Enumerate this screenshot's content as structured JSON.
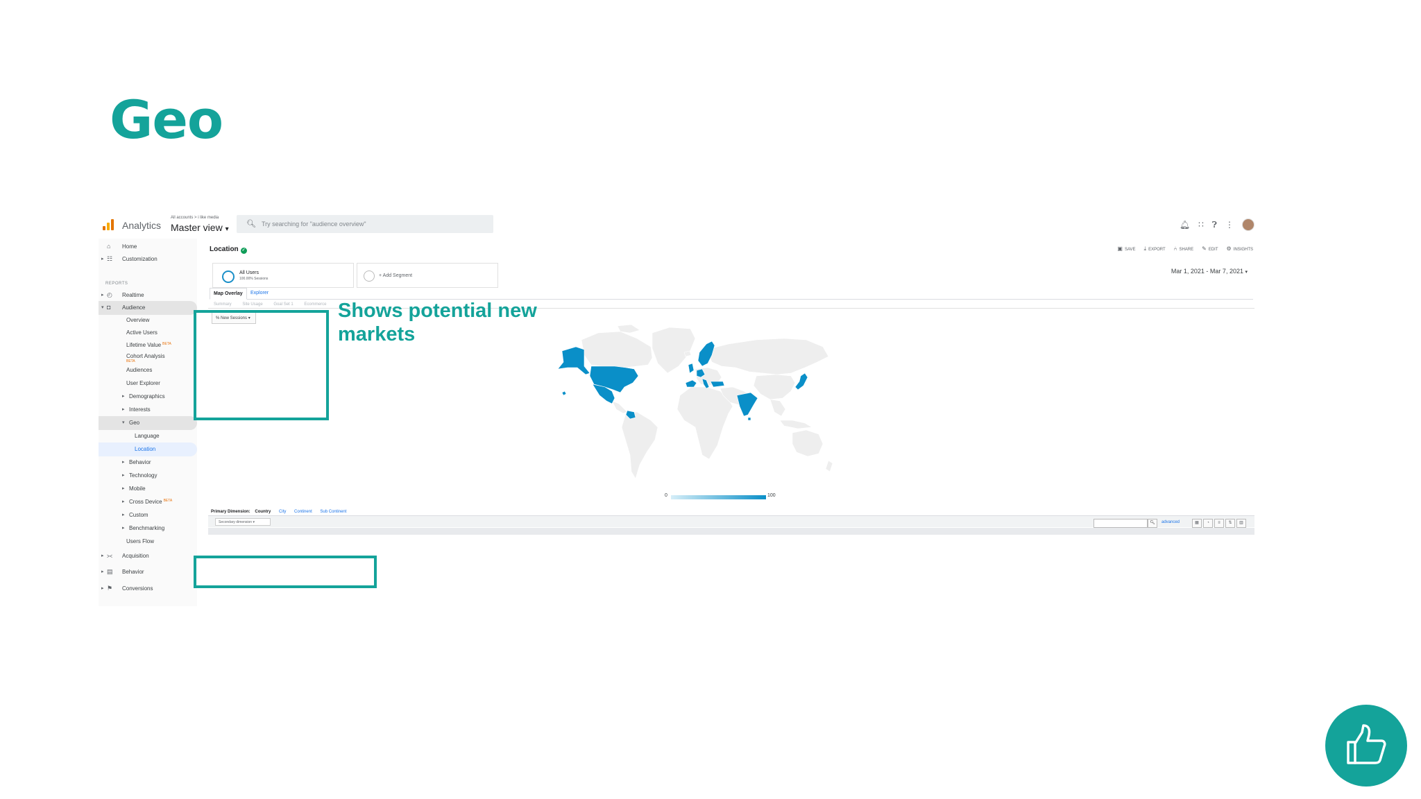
{
  "slide": {
    "title": "Geo"
  },
  "callout": {
    "text": "Shows potential new markets"
  },
  "app": {
    "name": "Analytics",
    "breadcrumb": "All accounts > i like media",
    "view": "Master view",
    "view_caret": "▾",
    "search_placeholder": "Try searching for \"audience overview\""
  },
  "sidebar": {
    "reports_label": "REPORTS",
    "items": [
      {
        "label": "Home"
      },
      {
        "label": "Customization"
      },
      {
        "label": "Realtime"
      },
      {
        "label": "Audience"
      },
      {
        "label": "Overview"
      },
      {
        "label": "Active Users"
      },
      {
        "label": "Lifetime Value",
        "badge": "BETA"
      },
      {
        "label": "Cohort Analysis",
        "badge": "BETA"
      },
      {
        "label": "Audiences"
      },
      {
        "label": "User Explorer"
      },
      {
        "label": "Demographics"
      },
      {
        "label": "Interests"
      },
      {
        "label": "Geo"
      },
      {
        "label": "Language"
      },
      {
        "label": "Location"
      },
      {
        "label": "Behavior"
      },
      {
        "label": "Technology"
      },
      {
        "label": "Mobile"
      },
      {
        "label": "Cross Device",
        "badge": "BETA"
      },
      {
        "label": "Custom"
      },
      {
        "label": "Benchmarking"
      },
      {
        "label": "Users Flow"
      },
      {
        "label": "Acquisition"
      },
      {
        "label": "Behavior"
      },
      {
        "label": "Conversions"
      }
    ]
  },
  "report": {
    "title": "Location",
    "actions": [
      "SAVE",
      "EXPORT",
      "SHARE",
      "EDIT",
      "INSIGHTS"
    ],
    "segment": {
      "name": "All Users",
      "sub": "100.00% Sessions"
    },
    "add_segment": "+ Add Segment",
    "date_range": "Mar 1, 2021 - Mar 7, 2021",
    "tabs": [
      "Map Overlay",
      "Explorer"
    ],
    "subtabs": [
      "Summary",
      "Site Usage",
      "Goal Set 1",
      "Ecommerce"
    ],
    "metric": "% New Sessions",
    "legend_min": "0",
    "legend_max": "100",
    "primary_dimension_label": "Primary Dimension:",
    "dimensions": [
      "Country",
      "City",
      "Continent",
      "Sub Continent"
    ],
    "secondary_dimension": "Secondary dimension",
    "advanced": "advanced"
  },
  "map_colors": {
    "highlight": "#0a8fc8",
    "land": "#eeeeee",
    "border": "#ffffff"
  },
  "highlighted_regions": [
    "Alaska",
    "United States",
    "Mexico",
    "Colombia",
    "Norway",
    "Sweden",
    "Finland",
    "United Kingdom",
    "Spain",
    "Germany",
    "Italy",
    "Turkey",
    "India",
    "Japan",
    "Hawaii"
  ]
}
